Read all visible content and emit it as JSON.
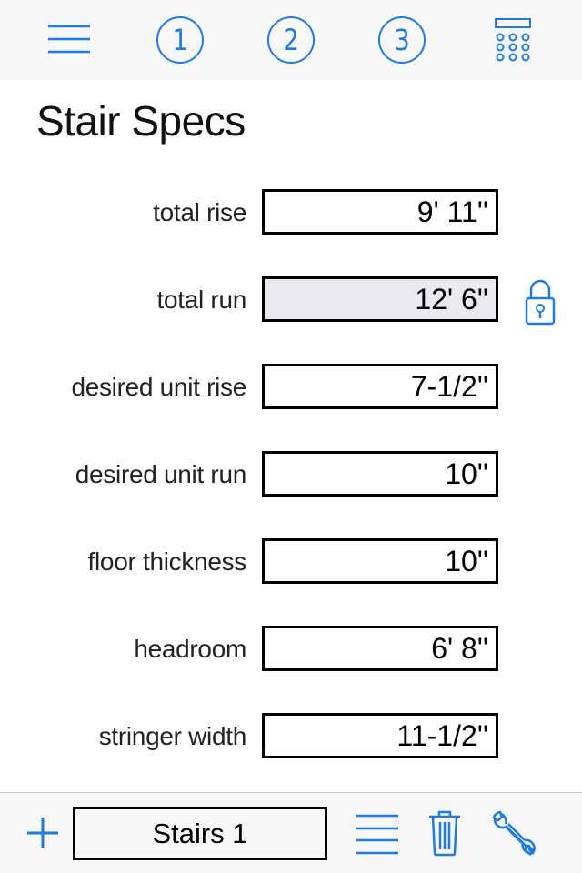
{
  "topbar": {
    "menu_icon": "hamburger-menu-icon",
    "steps": [
      {
        "label": "1",
        "icon": "circled-number-icon"
      },
      {
        "label": "2",
        "icon": "circled-number-icon"
      },
      {
        "label": "3",
        "icon": "circled-number-icon"
      }
    ],
    "calculator_icon": "calculator-icon"
  },
  "page": {
    "title": "Stair Specs"
  },
  "fields": [
    {
      "label": "total rise",
      "value": "9' 11''",
      "locked": false
    },
    {
      "label": "total run",
      "value": "12' 6''",
      "locked": true
    },
    {
      "label": "desired unit rise",
      "value": "7-1/2''",
      "locked": false
    },
    {
      "label": "desired unit run",
      "value": "10''",
      "locked": false
    },
    {
      "label": "floor thickness",
      "value": "10''",
      "locked": false
    },
    {
      "label": "headroom",
      "value": "6' 8''",
      "locked": false
    },
    {
      "label": "stringer width",
      "value": "11-1/2''",
      "locked": false
    }
  ],
  "lock": {
    "icon": "padlock-icon"
  },
  "bottombar": {
    "add_icon": "plus-icon",
    "project_name": "Stairs 1",
    "list_icon": "list-icon",
    "delete_icon": "trash-icon",
    "settings_icon": "wrench-icon"
  },
  "colors": {
    "accent": "#1f7be0",
    "bar_background": "#f7f7f7",
    "locked_field_background": "#e9e9ef"
  }
}
